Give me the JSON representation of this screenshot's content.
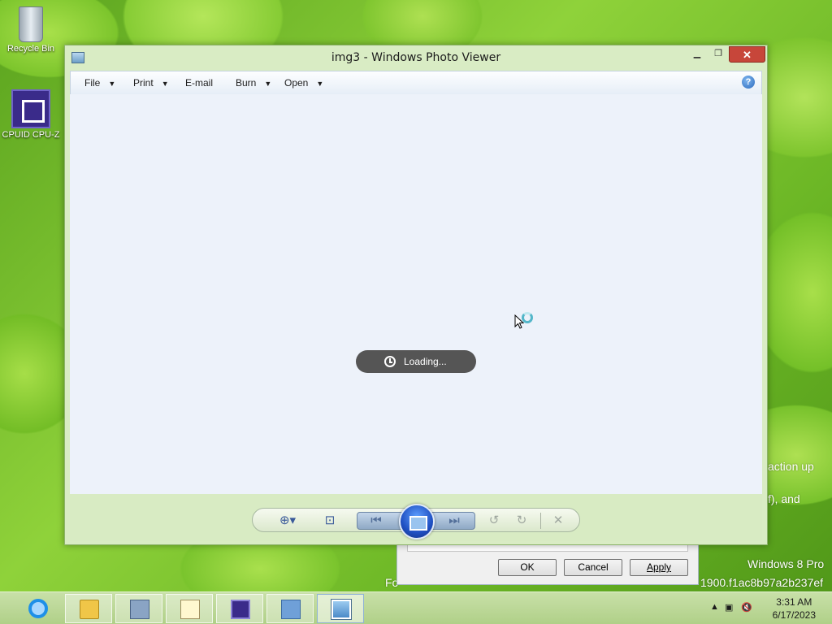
{
  "desktop": {
    "icons": [
      {
        "label": "Recycle Bin"
      },
      {
        "label": "CPUID CPU-Z"
      }
    ],
    "watermark_os": "Windows 8 Pro",
    "watermark_build": "1900.f1ac8b97a2b237ef",
    "partial_text_1": "action up",
    "partial_text_2": "f), and",
    "partial_text_3": "Fo"
  },
  "background_dialog": {
    "ok_label": "OK",
    "cancel_label": "Cancel",
    "apply_label": "Apply"
  },
  "window": {
    "title": "img3 - Windows Photo Viewer",
    "close_glyph": "✕",
    "menu": {
      "file": "File",
      "print": "Print",
      "email": "E-mail",
      "burn": "Burn",
      "open": "Open"
    },
    "help_glyph": "?",
    "loading_text": "Loading..."
  },
  "taskbar": {
    "time": "3:31 AM",
    "date": "6/17/2023",
    "apps": [
      "Internet Explorer",
      "File Explorer",
      "Performance Monitor",
      "Notepad",
      "CPUID CPU-Z",
      "Control Panel",
      "Windows Photo Viewer"
    ]
  }
}
